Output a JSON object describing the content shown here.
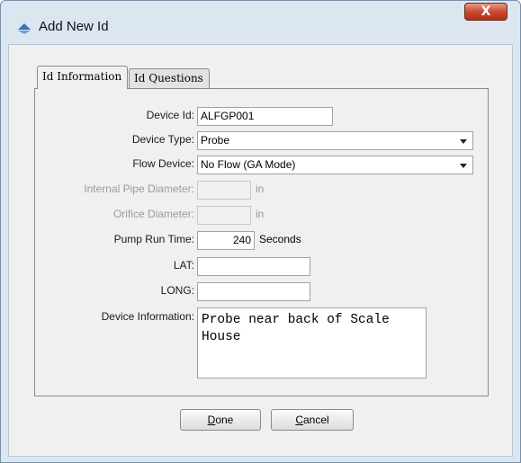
{
  "window": {
    "title": "Add New Id",
    "close_label": "X"
  },
  "tabs": [
    {
      "label": "Id Information",
      "active": true
    },
    {
      "label": "Id Questions",
      "active": false
    }
  ],
  "form": {
    "device_id": {
      "label": "Device Id:",
      "value": "ALFGP001"
    },
    "device_type": {
      "label": "Device Type:",
      "value": "Probe"
    },
    "flow_device": {
      "label": "Flow Device:",
      "value": "No Flow (GA Mode)"
    },
    "internal_pipe_diameter": {
      "label": "Internal Pipe Diameter:",
      "value": "",
      "unit": "in"
    },
    "orifice_diameter": {
      "label": "Orifice Diameter:",
      "value": "",
      "unit": "in"
    },
    "pump_run_time": {
      "label": "Pump Run Time:",
      "value": "240",
      "unit": "Seconds"
    },
    "lat": {
      "label": "LAT:",
      "value": ""
    },
    "long": {
      "label": "LONG:",
      "value": ""
    },
    "device_information": {
      "label": "Device Information:",
      "value": "Probe near back of Scale House"
    }
  },
  "buttons": {
    "done": {
      "mnemonic": "D",
      "rest": "one"
    },
    "cancel": {
      "mnemonic": "C",
      "rest": "ancel"
    }
  },
  "colors": {
    "window_frame": "#dbe6f1",
    "close_button": "#c9452c"
  },
  "icons": {
    "app": "diamond-arrow-icon"
  }
}
